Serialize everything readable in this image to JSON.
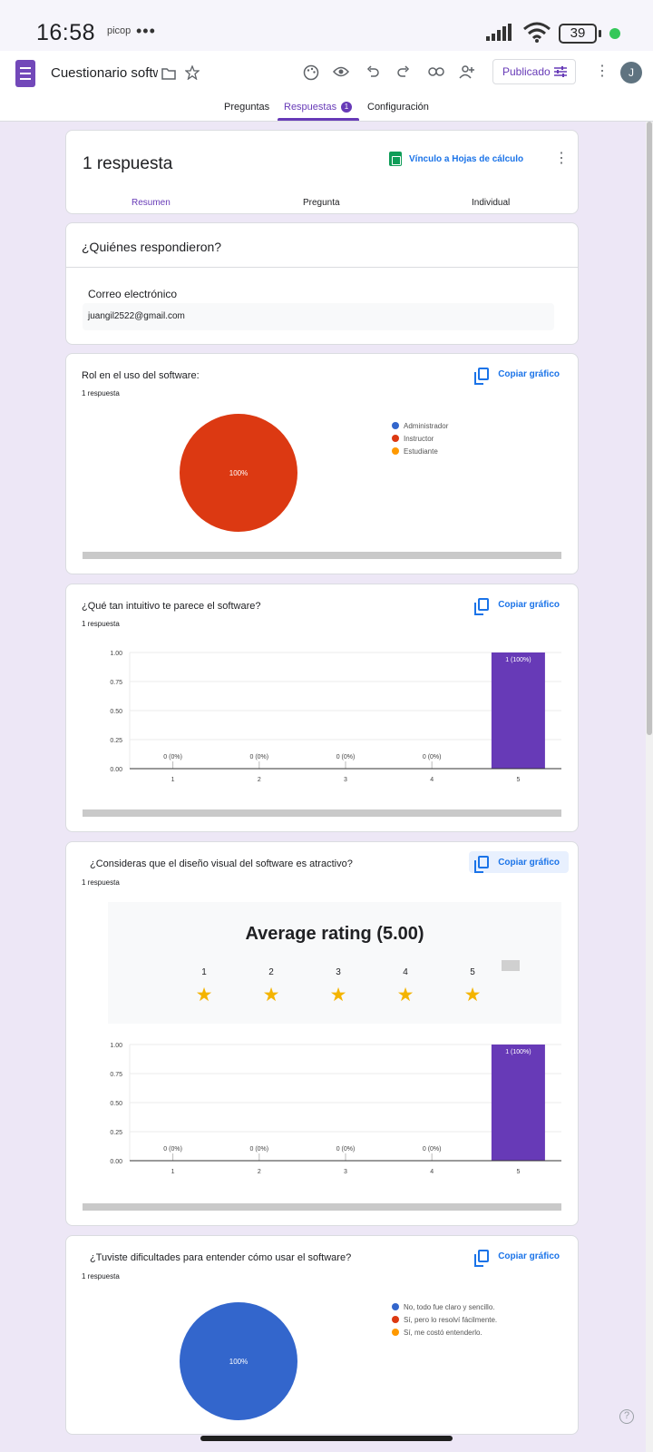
{
  "status_bar": {
    "time": "16:58",
    "app_indicator": "picop",
    "more": "•••",
    "battery": "39"
  },
  "app": {
    "title": "Cuestionario softwa",
    "publish_label": "Publicado",
    "avatar_letter": "J",
    "tabs": [
      {
        "label": "Preguntas"
      },
      {
        "label": "Respuestas",
        "badge": "1"
      },
      {
        "label": "Configuración"
      }
    ]
  },
  "summary": {
    "responses_title": "1 respuesta",
    "sheets_link": "Vínculo a Hojas de cálculo",
    "subtabs": [
      "Resumen",
      "Pregunta",
      "Individual"
    ]
  },
  "who": {
    "title": "¿Quiénes respondieron?",
    "field_label": "Correo electrónico",
    "email": "juangil2522@gmail.com"
  },
  "copy_label": "Copiar gráfico",
  "questions": [
    {
      "title": "Rol en el uso del software:",
      "count": "1 respuesta",
      "legend": [
        {
          "label": "Administrador",
          "color": "#3366cc"
        },
        {
          "label": "Instructor",
          "color": "#dc3912"
        },
        {
          "label": "Estudiante",
          "color": "#ff9900"
        }
      ]
    },
    {
      "title": "¿Qué tan intuitivo te parece el software?",
      "count": "1 respuesta"
    },
    {
      "title": "¿Consideras que el diseño visual del software es atractivo?",
      "count": "1 respuesta",
      "rating_title": "Average rating (5.00)",
      "rating_levels": [
        "1",
        "2",
        "3",
        "4",
        "5"
      ],
      "star": "★"
    },
    {
      "title": "¿Tuviste dificultades para entender cómo usar el software?",
      "count": "1 respuesta",
      "legend": [
        {
          "label": "No, todo fue claro y sencillo.",
          "color": "#3366cc"
        },
        {
          "label": "Sí, pero lo resolví fácilmente.",
          "color": "#dc3912"
        },
        {
          "label": "Sí, me costó entenderlo.",
          "color": "#ff9900"
        }
      ]
    }
  ],
  "chart_data": [
    {
      "type": "pie",
      "categories": [
        "Administrador",
        "Instructor",
        "Estudiante"
      ],
      "values": [
        0,
        1,
        0
      ],
      "slice_label": "100%",
      "colors": [
        "#3366cc",
        "#dc3912",
        "#ff9900"
      ],
      "legend": "right"
    },
    {
      "type": "bar",
      "categories": [
        "1",
        "2",
        "3",
        "4",
        "5"
      ],
      "values": [
        0,
        0,
        0,
        0,
        1
      ],
      "data_labels": [
        "0 (0%)",
        "0 (0%)",
        "0 (0%)",
        "0 (0%)",
        "1 (100%)"
      ],
      "yticks": [
        "0.00",
        "0.25",
        "0.50",
        "0.75",
        "1.00"
      ],
      "ylim": [
        0,
        1
      ],
      "color": "#673ab7"
    },
    {
      "type": "bar",
      "categories": [
        "1",
        "2",
        "3",
        "4",
        "5"
      ],
      "values": [
        0,
        0,
        0,
        0,
        1
      ],
      "data_labels": [
        "0 (0%)",
        "0 (0%)",
        "0 (0%)",
        "0 (0%)",
        "1 (100%)"
      ],
      "yticks": [
        "0.00",
        "0.25",
        "0.50",
        "0.75",
        "1.00"
      ],
      "ylim": [
        0,
        1
      ],
      "color": "#673ab7"
    },
    {
      "type": "pie",
      "categories": [
        "No, todo fue claro y sencillo.",
        "Sí, pero lo resolví fácilmente.",
        "Sí, me costó entenderlo."
      ],
      "values": [
        1,
        0,
        0
      ],
      "slice_label": "100%",
      "colors": [
        "#3366cc",
        "#dc3912",
        "#ff9900"
      ],
      "legend": "right"
    }
  ]
}
